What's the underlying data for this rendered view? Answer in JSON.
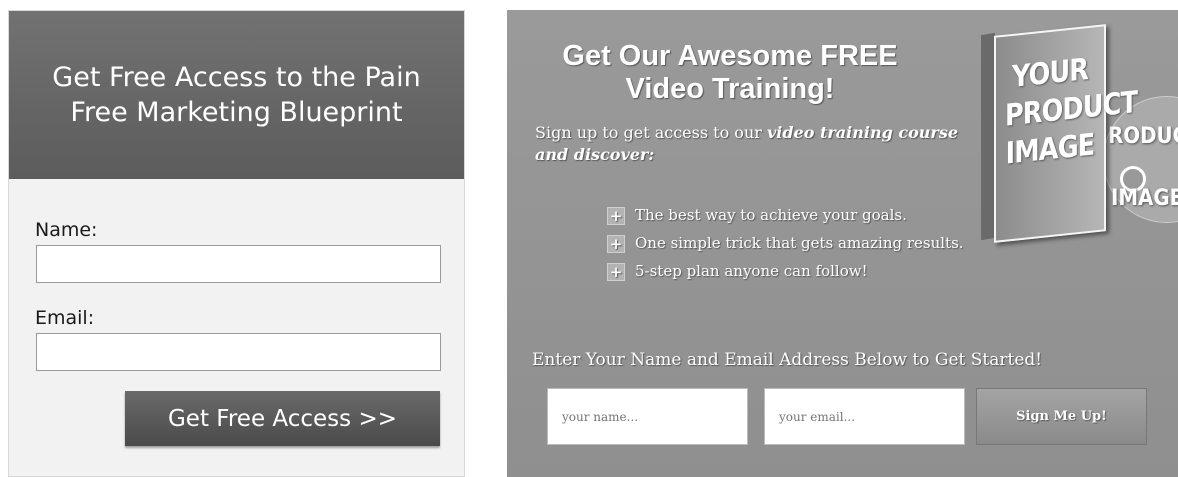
{
  "left_form": {
    "heading": "Get Free Access to the Pain Free Marketing Blueprint",
    "name_label": "Name:",
    "email_label": "Email:",
    "submit_label": "Get Free Access >>"
  },
  "right_form": {
    "title_line1": "Get Our Awesome FREE",
    "title_line2": "Video Training!",
    "subtitle_plain": "Sign up to get access to our ",
    "subtitle_emphasis": "video training course and discover:",
    "bullets": [
      "The best way to achieve your goals.",
      "One simple trick that gets amazing results.",
      "5-step plan anyone can follow!"
    ],
    "cta": "Enter Your Name and Email Address Below to Get Started!",
    "name_placeholder": "your name...",
    "email_placeholder": "your email...",
    "submit_label": "Sign Me Up!",
    "product_box_text": [
      "YOUR",
      "PRODUCT",
      "IMAGE"
    ],
    "product_disc_text": [
      "RODUCT",
      "IMAGE"
    ],
    "bullet_icon": "plus-icon"
  }
}
